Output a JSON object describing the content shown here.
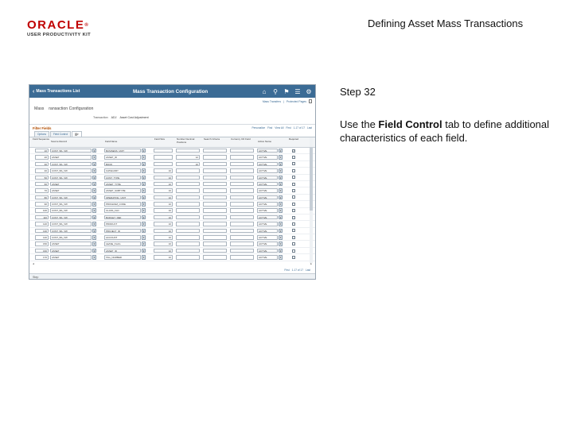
{
  "slide": {
    "logo_oracle": "ORACLE",
    "logo_registered": "®",
    "logo_subtitle": "USER PRODUCTIVITY KIT",
    "title": "Defining Asset Mass Transactions",
    "step_label": "Step 32",
    "instruction_pre": "Use the ",
    "instruction_bold": "Field Control",
    "instruction_post": " tab to define additional characteristics of each field."
  },
  "screenshot": {
    "back_label": "Mass Transactions List",
    "page_title": "Mass Transaction Configuration",
    "header_icons": [
      "home-icon",
      "search-icon",
      "actions-icon",
      "menu-icon",
      "gear-icon"
    ],
    "links": [
      "Mass Transfers",
      "Protected Pages"
    ],
    "breadcrumb_a": "Mass",
    "breadcrumb_b": "ransaction Configuration",
    "transaction_label": "Transaction",
    "transaction_value": "ADJ",
    "transaction_desc": "Asset Cost Adjustment",
    "grid_title": "Filter Fields",
    "grid_nav": [
      "Personalize",
      "Find",
      "View All",
      "First",
      "1-17 of 17",
      "Last"
    ],
    "tabs": [
      {
        "label": "Options",
        "active": false
      },
      {
        "label": "Field Control",
        "active": false
      },
      {
        "label": "|||>",
        "active": true
      }
    ],
    "columns": [
      "Field Sequence",
      "Source Record",
      "Field Name",
      "Field Size",
      "Number Decimal Positions",
      "Search Criteria",
      "Currency CD Field",
      "Active Name",
      "Required"
    ],
    "rows": [
      {
        "seq": "10",
        "src": "COST_BA_VW",
        "fld": "BUSINESS_UNIT",
        "len": "",
        "dec": "",
        "srch": "",
        "cur": "",
        "act": "ACTIVE",
        "req": true
      },
      {
        "seq": "20",
        "src": "ASSET",
        "fld": "ASSET_ID",
        "len": "",
        "dec": "12",
        "srch": "",
        "cur": "",
        "act": "ACTIVE",
        "req": false
      },
      {
        "seq": "30",
        "src": "COST_BA_VW",
        "fld": "BOOK",
        "len": "",
        "dec": "10",
        "srch": "",
        "cur": "",
        "act": "ACTIVE",
        "req": false
      },
      {
        "seq": "40",
        "src": "COST_BA_VW",
        "fld": "CATEGORY",
        "len": "10",
        "dec": "",
        "srch": "",
        "cur": "",
        "act": "ACTIVE",
        "req": false
      },
      {
        "seq": "50",
        "src": "COST_BA_VW",
        "fld": "COST_TYPE",
        "len": "10",
        "dec": "",
        "srch": "",
        "cur": "",
        "act": "ACTIVE",
        "req": false
      },
      {
        "seq": "60",
        "src": "ASSET",
        "fld": "ASSET_TYPE",
        "len": "10",
        "dec": "",
        "srch": "",
        "cur": "",
        "act": "ACTIVE",
        "req": false
      },
      {
        "seq": "70",
        "src": "ASSET",
        "fld": "ASSET_SUBTYPE",
        "len": "10",
        "dec": "",
        "srch": "",
        "cur": "",
        "act": "ACTIVE",
        "req": false
      },
      {
        "seq": "80",
        "src": "COST_BA_VW",
        "fld": "OPERATING_UNIT",
        "len": "10",
        "dec": "",
        "srch": "",
        "cur": "",
        "act": "ACTIVE",
        "req": false
      },
      {
        "seq": "90",
        "src": "COST_BA_VW",
        "fld": "PROGRAM_CODE",
        "len": "10",
        "dec": "",
        "srch": "",
        "cur": "",
        "act": "ACTIVE",
        "req": false
      },
      {
        "seq": "100",
        "src": "COST_BA_VW",
        "fld": "CLASS_FLD",
        "len": "10",
        "dec": "",
        "srch": "",
        "cur": "",
        "act": "ACTIVE",
        "req": false
      },
      {
        "seq": "110",
        "src": "COST_BA_VW",
        "fld": "BUDGET_REF",
        "len": "10",
        "dec": "",
        "srch": "",
        "cur": "",
        "act": "ACTIVE",
        "req": false
      },
      {
        "seq": "120",
        "src": "COST_BA_VW",
        "fld": "PRODUCT",
        "len": "10",
        "dec": "",
        "srch": "",
        "cur": "",
        "act": "ACTIVE",
        "req": false
      },
      {
        "seq": "130",
        "src": "COST_BA_VW",
        "fld": "PROJECT_ID",
        "len": "10",
        "dec": "",
        "srch": "",
        "cur": "",
        "act": "ACTIVE",
        "req": false
      },
      {
        "seq": "140",
        "src": "COST_BA_VW",
        "fld": "ACCOUNT",
        "len": "10",
        "dec": "",
        "srch": "",
        "cur": "",
        "act": "ACTIVE",
        "req": false
      },
      {
        "seq": "150",
        "src": "ASSET",
        "fld": "LEASE_FLAG",
        "len": "10",
        "dec": "",
        "srch": "",
        "cur": "",
        "act": "ACTIVE",
        "req": false
      },
      {
        "seq": "160",
        "src": "ASSET",
        "fld": "ASSET_ID",
        "len": "10",
        "dec": "",
        "srch": "",
        "cur": "",
        "act": "ACTIVE",
        "req": false
      },
      {
        "seq": "170",
        "src": "ASSET",
        "fld": "TAG_NUMBER",
        "len": "10",
        "dec": "",
        "srch": "",
        "cur": "",
        "act": "ACTIVE",
        "req": false
      }
    ],
    "footer_nav": [
      "First",
      "1-17 of 17",
      "Last"
    ],
    "step_bar": "Step"
  }
}
